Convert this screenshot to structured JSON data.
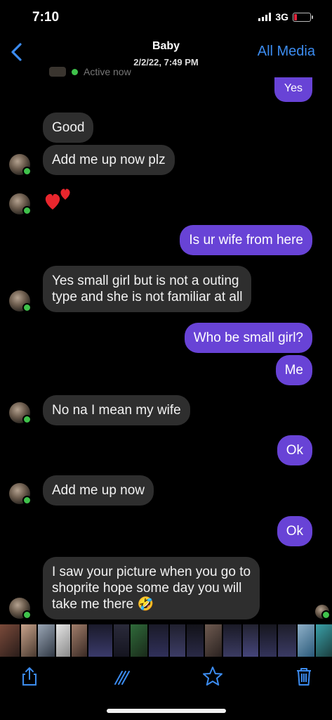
{
  "status": {
    "time": "7:10",
    "network": "3G"
  },
  "nav": {
    "title": "Baby",
    "subtitle": "2/2/22, 7:49 PM",
    "all_media": "All Media"
  },
  "active_status": "Active now",
  "messages": [
    {
      "from": "me",
      "text": "Yes"
    },
    {
      "from": "them",
      "text": "Good"
    },
    {
      "from": "them",
      "text": "Add me up now plz"
    },
    {
      "from": "them",
      "emoji": "two-hearts"
    },
    {
      "from": "me",
      "text": "Is ur wife from here"
    },
    {
      "from": "them",
      "text": "Yes small girl but is not a outing\ntype and she is not familiar at all"
    },
    {
      "from": "me",
      "text": "Who be small girl?"
    },
    {
      "from": "me",
      "text": "Me"
    },
    {
      "from": "them",
      "text": "No na I mean my wife"
    },
    {
      "from": "me",
      "text": "Ok"
    },
    {
      "from": "them",
      "text": "Add me up now"
    },
    {
      "from": "me",
      "text": "Ok"
    },
    {
      "from": "them",
      "text": "I saw your picture when you go to\nshoprite hope some day you will\ntake me there 🤣"
    }
  ],
  "toolbar": {
    "icons": [
      "share-icon",
      "markup-icon",
      "favorite-star-icon",
      "trash-icon"
    ]
  },
  "colors": {
    "accent": "#3c8cf0",
    "outgoing_bubble": "#6843d6",
    "incoming_bubble": "#2e2e2e"
  }
}
